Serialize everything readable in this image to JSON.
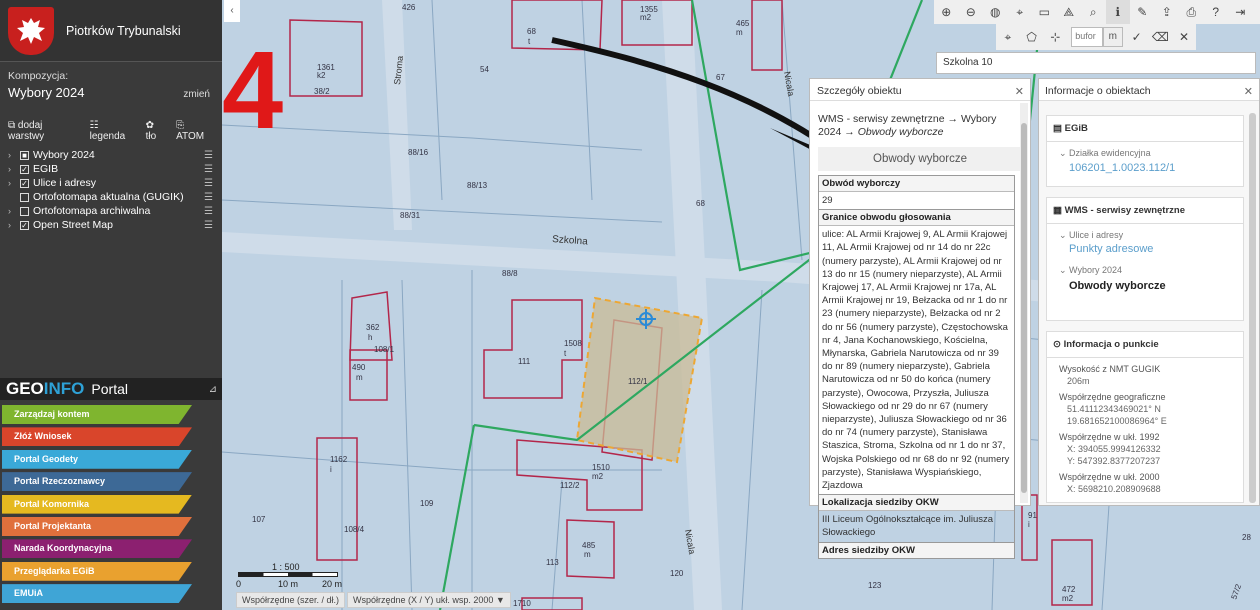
{
  "app": {
    "city": "Piotrków Trybunalski"
  },
  "composition": {
    "label": "Kompozycja:",
    "value": "Wybory 2024",
    "change": "zmień"
  },
  "layer_tools": {
    "add": "dodaj warstwy",
    "legend": "legenda",
    "background": "tło",
    "atom": "ATOM"
  },
  "layers": [
    {
      "name": "Wybory 2024",
      "checked": "partial",
      "tree": true
    },
    {
      "name": "EGIB",
      "checked": true,
      "tree": true
    },
    {
      "name": "Ulice i adresy",
      "checked": true,
      "tree": true
    },
    {
      "name": "Ortofotomapa aktualna (GUGIK)",
      "checked": false,
      "tree": false
    },
    {
      "name": "Ortofotomapa archiwalna",
      "checked": false,
      "tree": true
    },
    {
      "name": "Open Street Map",
      "checked": true,
      "tree": true
    }
  ],
  "geoinfo": {
    "geo": "GEO",
    "info": "INFO",
    "portal": "Portal"
  },
  "portals": [
    {
      "label": "Zarządzaj kontem",
      "color": "#7fb52f"
    },
    {
      "label": "Złóż Wniosek",
      "color": "#d9452b"
    },
    {
      "label": "Portal Geodety",
      "color": "#3aa9d8"
    },
    {
      "label": "Portal Rzeczoznawcy",
      "color": "#3d6996"
    },
    {
      "label": "Portal Komornika",
      "color": "#e5b920"
    },
    {
      "label": "Portal Projektanta",
      "color": "#e0703c"
    },
    {
      "label": "Narada Koordynacyjna",
      "color": "#8c2070"
    },
    {
      "label": "Przeglądarka EGiB",
      "color": "#e9a12f"
    },
    {
      "label": "EMUiA",
      "color": "#3fa5d6"
    }
  ],
  "toolbar": {
    "bufor_placeholder": "bufor",
    "unit": "m"
  },
  "search": {
    "value": "Szkolna 10"
  },
  "details": {
    "title": "Szczegóły obiektu",
    "path_main": "WMS - serwisy zewnętrzne → Wybory 2024 →",
    "path_italic": "Obwody wyborcze",
    "section_title": "Obwody wyborcze",
    "rows": [
      {
        "h": "Obwód wyborczy",
        "v": "29"
      },
      {
        "h": "Granice obwodu głosowania",
        "v": "ulice: AL Armii Krajowej 9, AL Armii Krajowej 11, AL Armii Krajowej od nr 14 do nr 22c (numery parzyste), AL Armii Krajowej od nr 13 do nr 15 (numery nieparzyste), AL Armii Krajowej 17, AL Armii Krajowej nr 17a, AL Armii Krajowej nr 19, Bełzacka od nr 1 do nr 23 (numery nieparzyste), Bełzacka od nr 2 do nr 56 (numery parzyste), Częstochowska nr 4, Jana Kochanowskiego, Kościelna, Młynarska, Gabriela Narutowicza od nr 39 do nr 89 (numery nieparzyste), Gabriela Narutowicza od nr 50 do końca (numery parzyste), Owocowa, Przyszła, Juliusza Słowackiego od nr 29 do nr 67 (numery nieparzyste), Juliusza Słowackiego od nr 36 do nr 74 (numery parzyste), Stanisława Staszica, Stroma, Szkolna od nr 1 do nr 37, Wojska Polskiego od nr 68 do nr 92 (numery parzyste), Stanisława Wyspiańskiego, Zjazdowa"
      },
      {
        "h": "Lokalizacja siedziby OKW",
        "v": "III Liceum Ogólnokształcące im. Juliusza Słowackiego"
      },
      {
        "h": "Adres siedziby OKW",
        "v": ""
      }
    ]
  },
  "objinfo": {
    "title": "Informacje o obiektach",
    "egib_title": "EGiB",
    "egib_sub": "Działka ewidencyjna",
    "egib_link": "106201_1.0023.112/1",
    "wms_title": "WMS - serwisy zewnętrzne",
    "wms_sub1": "Ulice i adresy",
    "wms_link1": "Punkty adresowe",
    "wms_sub2": "Wybory 2024",
    "wms_link2": "Obwody wyborcze",
    "pt_title": "Informacja o punkcie",
    "pt_items": [
      {
        "k": "Wysokość z NMT GUGIK",
        "v": [
          "206m"
        ]
      },
      {
        "k": "Współrzędne geograficzne",
        "v": [
          "51.41112343469021° N",
          "19.681652100086964° E"
        ]
      },
      {
        "k": "Współrzędne w ukł. 1992",
        "v": [
          "X: 394055.9994126332",
          "Y: 547392.8377207237"
        ]
      },
      {
        "k": "Współrzędne w ukł. 2000",
        "v": [
          "X: 5698210.208909688"
        ]
      }
    ]
  },
  "map": {
    "big_number": "4",
    "streets": [
      "Szkolna",
      "Stroma",
      "Nicala"
    ],
    "parcels": [
      "426",
      "54",
      "68",
      "t",
      "1355",
      "m2",
      "465",
      "m",
      "1361",
      "k2",
      "38/2",
      "88/16",
      "88/13",
      "88/31",
      "88/8",
      "362",
      "h",
      "108/1",
      "490",
      "m",
      "111",
      "1508",
      "t",
      "112/1",
      "1162",
      "i",
      "1510",
      "m2",
      "112/2",
      "109",
      "108/4",
      "107",
      "485",
      "m",
      "113",
      "120",
      "123",
      "1710",
      "67",
      "68",
      "91",
      "i",
      "472",
      "m2",
      "57/2",
      "28"
    ],
    "scale": {
      "ratio": "1 : 500",
      "ticks": [
        "0",
        "10 m",
        "20 m"
      ]
    }
  },
  "coords": {
    "a": "Współrzędne (szer. / dł.)",
    "b": "Współrzędne (X / Y) ukł. wsp. 2000 ▼"
  }
}
